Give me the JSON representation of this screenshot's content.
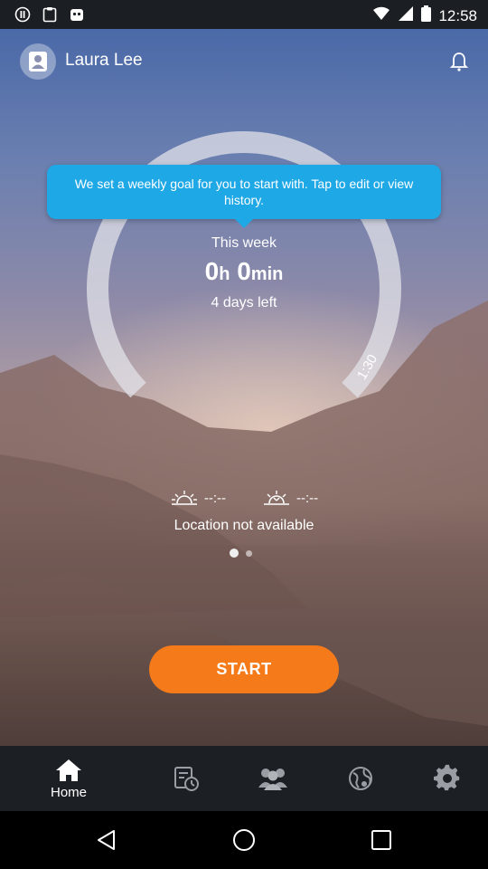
{
  "status_bar": {
    "time": "12:58"
  },
  "header": {
    "user_name": "Laura Lee"
  },
  "tooltip": {
    "text": "We set a weekly goal for you to start with. Tap to edit or view history."
  },
  "goal": {
    "label": "This week",
    "hours_value": "0",
    "hours_unit": "h",
    "minutes_value": "0",
    "minutes_unit": "min",
    "days_left": "4 days left",
    "ring_label": "1:30",
    "progress_fraction": 0
  },
  "sun": {
    "sunrise": "--:--",
    "sunset": "--:--"
  },
  "location_text": "Location not available",
  "pager": {
    "pages": 2,
    "active_index": 0
  },
  "start_label": "START",
  "tabs": [
    {
      "id": "home",
      "label": "Home",
      "icon": "home-icon",
      "active": true
    },
    {
      "id": "history",
      "label": "",
      "icon": "workout-history-icon",
      "active": false
    },
    {
      "id": "friends",
      "label": "",
      "icon": "friends-icon",
      "active": false
    },
    {
      "id": "explore",
      "label": "",
      "icon": "explore-globe-icon",
      "active": false
    },
    {
      "id": "settings",
      "label": "",
      "icon": "settings-gear-icon",
      "active": false
    }
  ],
  "colors": {
    "accent": "#1fa8e6",
    "start": "#f47a1a",
    "tabbar": "#1c1f23"
  }
}
